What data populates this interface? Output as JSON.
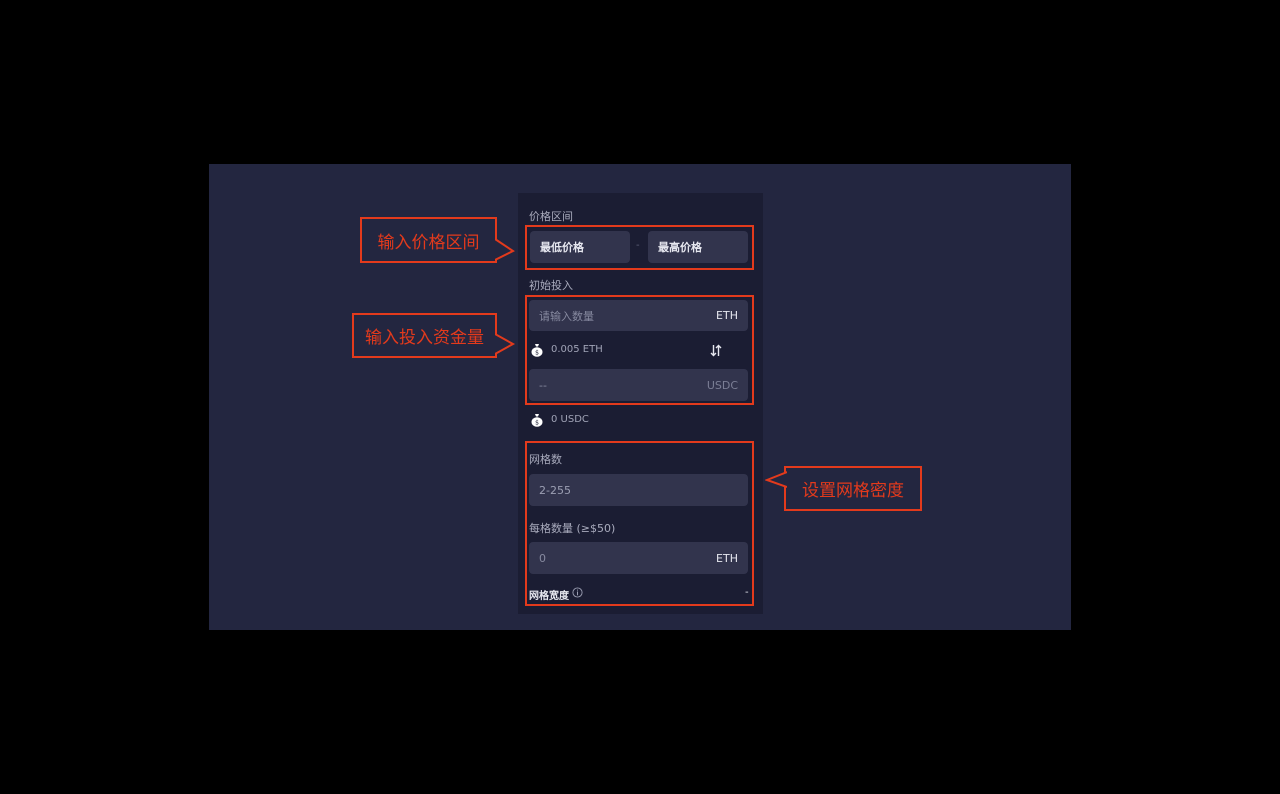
{
  "panel": {
    "price_range": {
      "label": "价格区间",
      "min_placeholder": "最低价格",
      "separator": "-",
      "max_placeholder": "最高价格"
    },
    "initial_investment": {
      "label": "初始投入",
      "eth_placeholder": "请输入数量",
      "eth_unit": "ETH",
      "eth_balance": "0.005 ETH",
      "usdc_value": "--",
      "usdc_unit": "USDC",
      "usdc_balance": "0 USDC"
    },
    "grid": {
      "count_label": "网格数",
      "count_placeholder": "2-255",
      "per_grid_label": "每格数量 (≥$50)",
      "per_grid_value": "0",
      "per_grid_unit": "ETH",
      "width_label": "网格宽度",
      "width_value": "-"
    }
  },
  "annotations": {
    "price_callout": "输入价格区间",
    "investment_callout": "输入投入资金量",
    "grid_callout": "设置网格密度"
  },
  "colors": {
    "page_background": "#000000",
    "stage_background": "#232640",
    "panel_background": "#1b1d33",
    "field_background": "#32344d",
    "annotation_red": "#e33a1c"
  },
  "icons": [
    "money-bag-icon",
    "swap-icon",
    "info-icon"
  ]
}
